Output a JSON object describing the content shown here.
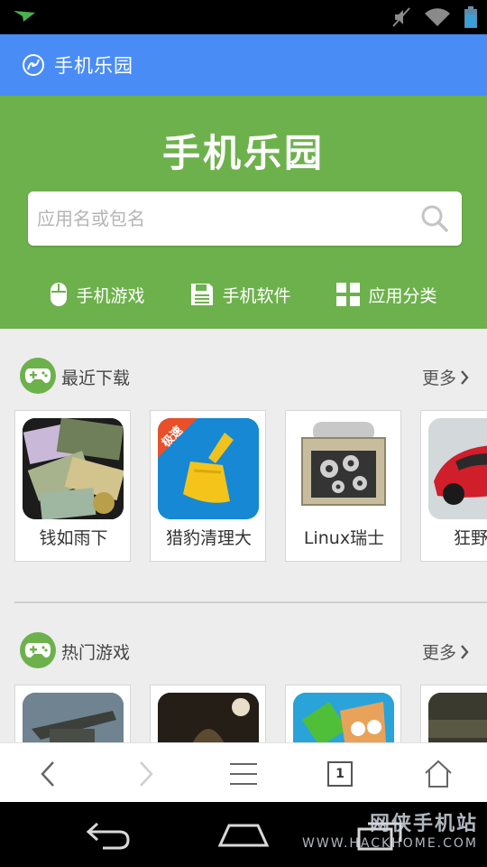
{
  "app": {
    "title": "手机乐园",
    "brand": "手机乐园"
  },
  "search": {
    "placeholder": "应用名或包名",
    "value": ""
  },
  "quicknav": [
    {
      "label": "手机游戏",
      "icon": "mouse-icon"
    },
    {
      "label": "手机软件",
      "icon": "floppy-disk-icon"
    },
    {
      "label": "应用分类",
      "icon": "grid-icon"
    }
  ],
  "sections": {
    "recent": {
      "title": "最近下载",
      "more": "更多",
      "apps": [
        {
          "name": "钱如雨下",
          "icon": "money-icon"
        },
        {
          "name": "猎豹清理大",
          "icon": "broom-icon",
          "badge": "极速"
        },
        {
          "name": "Linux瑞士",
          "icon": "gears-toolbox-icon"
        },
        {
          "name": "狂野飙",
          "icon": "race-car-icon"
        }
      ]
    },
    "hot": {
      "title": "热门游戏",
      "more": "更多",
      "apps": [
        {
          "name": "",
          "icon": "helicopter-icon"
        },
        {
          "name": "",
          "icon": "dungeon-icon"
        },
        {
          "name": "",
          "icon": "cartoon-gem-icon"
        },
        {
          "name": "",
          "icon": "dark-scene-icon"
        }
      ]
    }
  },
  "browser": {
    "tab_count": "1"
  },
  "watermark": {
    "line1": "网侠手机站",
    "line2": "WWW.HACKHOME.COM"
  },
  "colors": {
    "titlebar": "#4a8cf6",
    "hero": "#6db14c",
    "accent": "#6db14c"
  }
}
